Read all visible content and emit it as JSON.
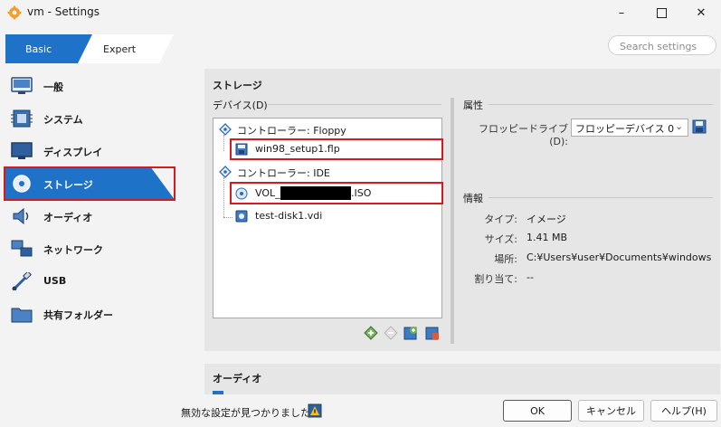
{
  "window": {
    "title": "vm - Settings",
    "minimize_icon": "minimize-icon",
    "maximize_icon": "maximize-icon",
    "close_icon": "close-icon"
  },
  "toolbar": {
    "tabs": [
      {
        "label": "Basic",
        "active": true
      },
      {
        "label": "Expert",
        "active": false
      }
    ],
    "search_placeholder": "Search settings"
  },
  "nav": {
    "items": [
      {
        "label": "一般",
        "icon": "general-icon"
      },
      {
        "label": "システム",
        "icon": "system-icon"
      },
      {
        "label": "ディスプレイ",
        "icon": "display-icon"
      },
      {
        "label": "ストレージ",
        "icon": "storage-icon",
        "selected": true
      },
      {
        "label": "オーディオ",
        "icon": "audio-icon"
      },
      {
        "label": "ネットワーク",
        "icon": "network-icon"
      },
      {
        "label": "USB",
        "icon": "usb-icon"
      },
      {
        "label": "共有フォルダー",
        "icon": "shared-folder-icon"
      }
    ]
  },
  "storage": {
    "section_title": "ストレージ",
    "devices_label": "デバイス(D)",
    "tree": [
      {
        "label": "コントローラー: Floppy",
        "type": "controller"
      },
      {
        "label": "win98_setup1.flp",
        "type": "floppy-image",
        "highlighted": true
      },
      {
        "label": "コントローラー: IDE",
        "type": "controller"
      },
      {
        "label_prefix": "VOL_",
        "label_suffix": ".ISO",
        "redacted": true,
        "type": "optical-image",
        "highlighted": true
      },
      {
        "label": "test-disk1.vdi",
        "type": "hard-disk"
      }
    ],
    "tree_actions": [
      "add-controller-icon",
      "remove-controller-icon",
      "add-attachment-icon",
      "remove-attachment-icon"
    ],
    "attributes": {
      "title": "属性",
      "floppy_drive_label": "フロッピードライブ(D):",
      "floppy_drive_value": "フロッピーデバイス 0",
      "choose_disk_icon": "floppy-disk-icon"
    },
    "info": {
      "title": "情報",
      "rows": [
        {
          "label": "タイプ:",
          "value": "イメージ"
        },
        {
          "label": "サイズ:",
          "value": "1.41 MB"
        },
        {
          "label": "場所:",
          "value": "C:¥Users¥user¥Documents¥windows..."
        },
        {
          "label": "割り当て:",
          "value": "--"
        }
      ]
    }
  },
  "audio_section": {
    "title": "オーディオ"
  },
  "footer": {
    "status": "無効な設定が見つかりました",
    "status_icon": "warning-icon",
    "ok": "OK",
    "cancel": "キャンセル",
    "help": "ヘルプ(H)"
  },
  "colors": {
    "accent": "#0078d7",
    "highlight_border": "#d71920"
  }
}
